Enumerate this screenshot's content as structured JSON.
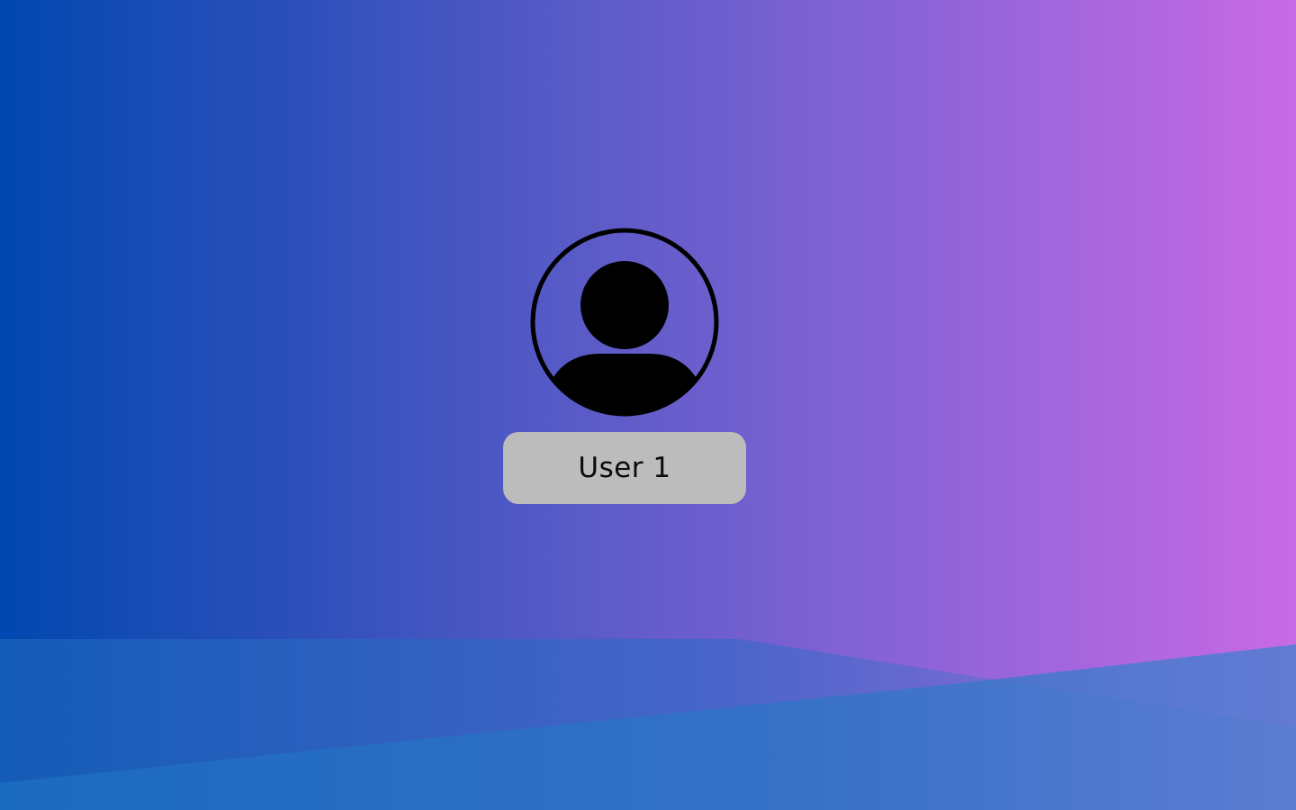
{
  "screen": {
    "type": "login-screen",
    "background_colors": [
      "#0148b0",
      "#5a5bc7",
      "#c86ae4"
    ],
    "wave_colors": [
      "#1868ba",
      "#2b6fc0",
      "#4b7bd0"
    ]
  },
  "user": {
    "avatar_icon": "user-avatar-icon",
    "name": "User 1",
    "button_color": "#bcbcbc"
  }
}
